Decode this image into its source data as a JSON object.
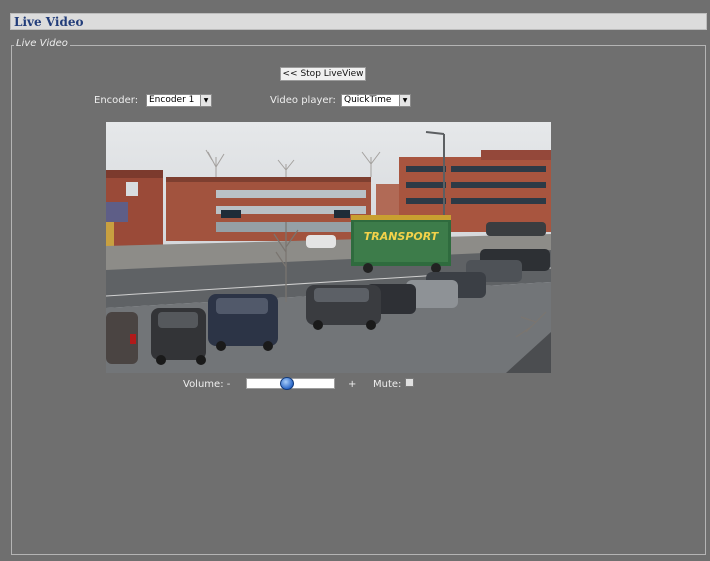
{
  "header": {
    "title": "Live Video"
  },
  "panel": {
    "legend": "Live Video"
  },
  "controls": {
    "stop_liveview_label": "<< Stop LiveView",
    "encoder_label": "Encoder:",
    "encoder_value": "Encoder 1",
    "video_player_label": "Video player:",
    "video_player_value": "QuickTime",
    "volume_label": "Volume: -",
    "volume_plus": "+",
    "mute_label": "Mute:",
    "volume_level": 0.45,
    "mute_checked": false
  },
  "video": {
    "truck_text": "TRANSPORT"
  },
  "colors": {
    "title_text": "#223d7a",
    "background": "#6f6f6f",
    "titlebar": "#dcdcdc"
  }
}
